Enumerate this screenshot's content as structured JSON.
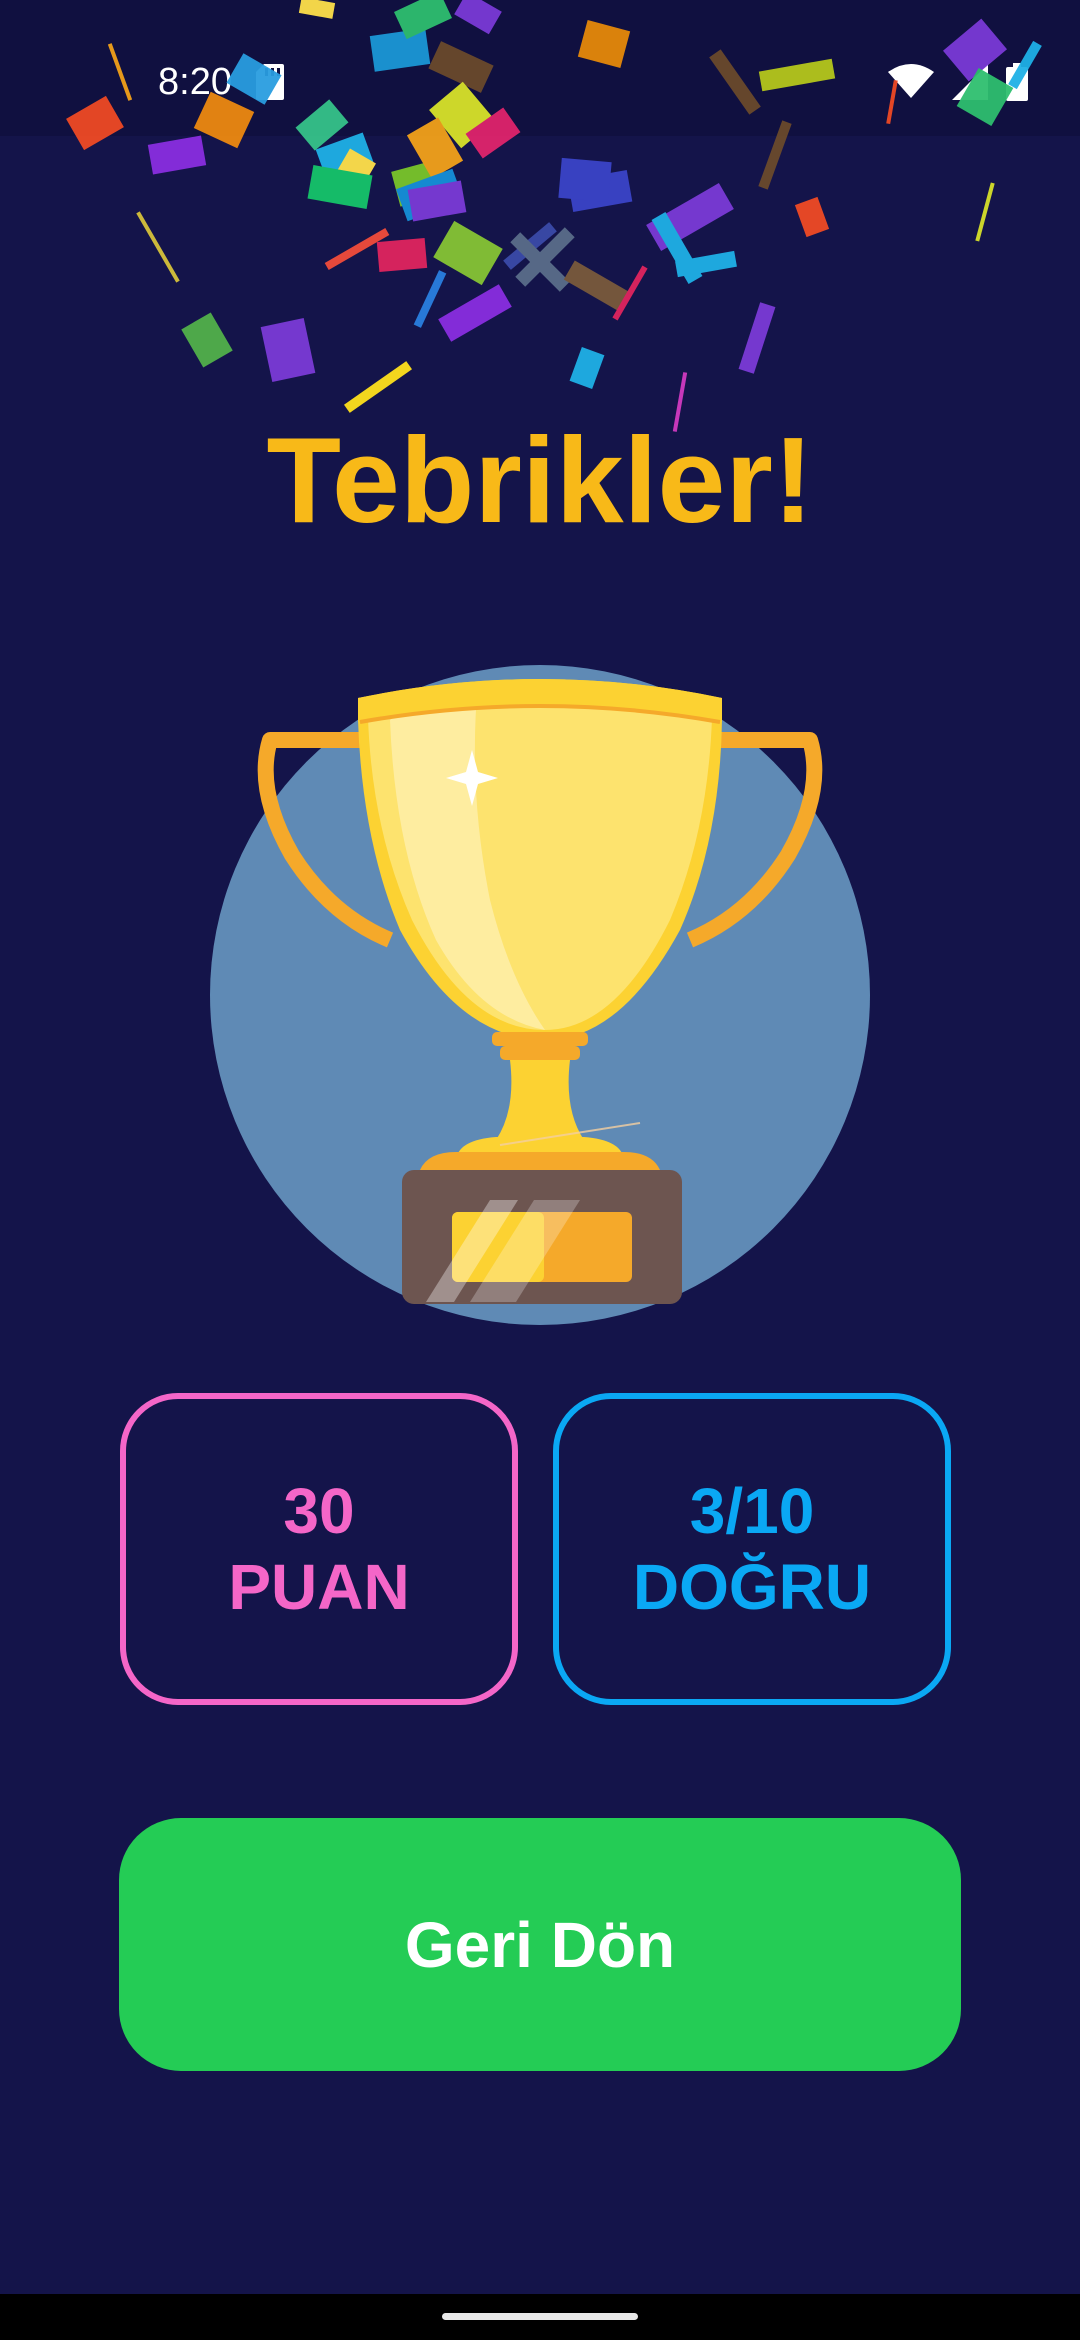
{
  "status_bar": {
    "time": "8:20",
    "icons": [
      "sd-card-icon",
      "wifi-icon",
      "cellular-signal-icon",
      "battery-icon"
    ]
  },
  "title": "Tebrikler!",
  "illustration": "trophy-icon",
  "stats": {
    "score": {
      "value": "30",
      "label": "PUAN"
    },
    "correct": {
      "value": "3/10",
      "label": "DOĞRU"
    }
  },
  "actions": {
    "back_label": "Geri Dön"
  },
  "colors": {
    "background": "#14144a",
    "title": "#f8b918",
    "score_accent": "#f466c8",
    "correct_accent": "#0aa8f4",
    "button": "#24cc55",
    "trophy_circle": "#5f8ab5"
  }
}
